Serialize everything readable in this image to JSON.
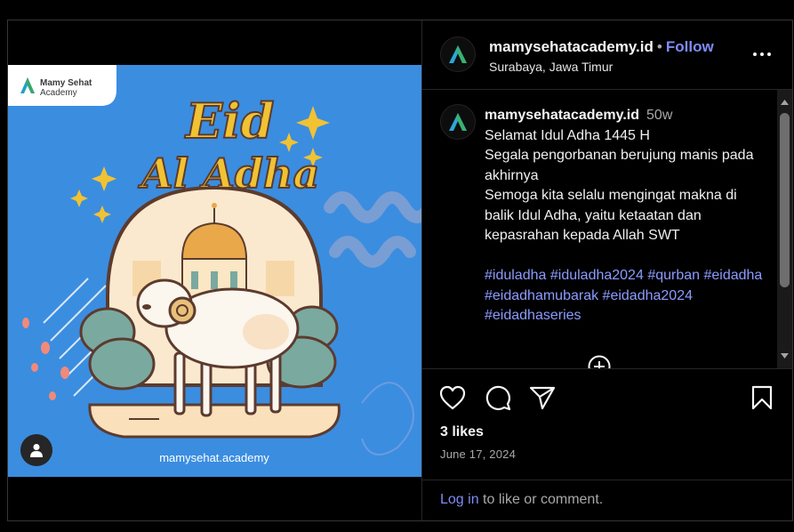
{
  "post": {
    "image": {
      "brand_line1": "Mamy Sehat",
      "brand_line2": "Academy",
      "title_line1": "Eid",
      "title_line2": "Al Adha",
      "footer": "mamysehat.academy",
      "colors": {
        "background": "#3b8de0",
        "gold": "#f1c232",
        "dome": "#e9a84a",
        "bush": "#7aa9a0",
        "sheep": "#fbf6ee",
        "outline": "#5c3b2e"
      }
    },
    "tag_icon": "user-tag-icon"
  },
  "header": {
    "username": "mamysehatacademy.id",
    "separator": "•",
    "follow_label": "Follow",
    "location": "Surabaya, Jawa Timur",
    "more_icon": "more-horizontal-icon"
  },
  "caption": {
    "username": "mamysehatacademy.id",
    "time": "50w",
    "lines": [
      "Selamat Idul Adha 1445 H",
      "Segala pengorbanan berujung manis pada akhirnya",
      "Semoga kita selalu mengingat makna di balik Idul Adha, yaitu ketaatan dan kepasrahan kepada Allah SWT"
    ],
    "hashtags": [
      "#iduladha",
      "#iduladha2024",
      "#qurban",
      "#eidadha",
      "#eidadhamubarak",
      "#eidadha2024",
      "#eidadhaseries"
    ],
    "load_more_icon": "plus-circle-icon"
  },
  "actions": {
    "like_icon": "heart-icon",
    "comment_icon": "comment-icon",
    "share_icon": "send-icon",
    "save_icon": "bookmark-icon"
  },
  "stats": {
    "likes": "3 likes",
    "date": "June 17, 2024"
  },
  "login": {
    "link_label": "Log in",
    "suffix": "to like or comment."
  }
}
